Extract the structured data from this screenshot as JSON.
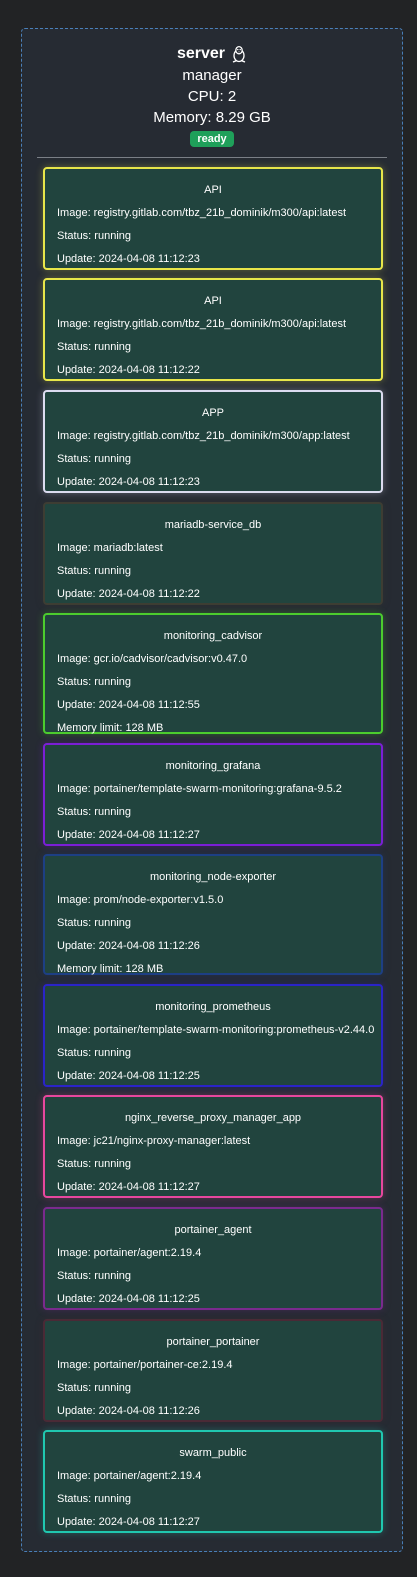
{
  "node": {
    "hostname": "server",
    "os_icon": "linux-tux-icon",
    "role": "manager",
    "cpu": "CPU: 2",
    "memory": "Memory: 8.29 GB",
    "status": "ready",
    "status_color": "#1fa05a",
    "border_color": "#4a7fb8"
  },
  "tasks": [
    {
      "name": "API",
      "image": "Image: registry.gitlab.com/tbz_21b_dominik/m300/api:latest",
      "status": "Status: running",
      "update": "Update: 2024-04-08 11:12:23",
      "color": "#e8e64a"
    },
    {
      "name": "API",
      "image": "Image: registry.gitlab.com/tbz_21b_dominik/m300/api:latest",
      "status": "Status: running",
      "update": "Update: 2024-04-08 11:12:22",
      "color": "#e8e64a"
    },
    {
      "name": "APP",
      "image": "Image: registry.gitlab.com/tbz_21b_dominik/m300/app:latest",
      "status": "Status: running",
      "update": "Update: 2024-04-08 11:12:23",
      "color": "#dcdcf0"
    },
    {
      "name": "mariadb-service_db",
      "image": "Image: mariadb:latest",
      "status": "Status: running",
      "update": "Update: 2024-04-08 11:12:22",
      "color": "#3d3d33"
    },
    {
      "name": "monitoring_cadvisor",
      "image": "Image: gcr.io/cadvisor/cadvisor:v0.47.0",
      "status": "Status: running",
      "update": "Update: 2024-04-08 11:12:55",
      "memory_limit": "Memory limit: 128 MB",
      "color": "#4ccc2e"
    },
    {
      "name": "monitoring_grafana",
      "image": "Image: portainer/template-swarm-monitoring:grafana-9.5.2",
      "status": "Status: running",
      "update": "Update: 2024-04-08 11:12:27",
      "color": "#7b1fd6"
    },
    {
      "name": "monitoring_node-exporter",
      "image": "Image: prom/node-exporter:v1.5.0",
      "status": "Status: running",
      "update": "Update: 2024-04-08 11:12:26",
      "memory_limit": "Memory limit: 128 MB",
      "color": "#1d3f84"
    },
    {
      "name": "monitoring_prometheus",
      "image": "Image: portainer/template-swarm-monitoring:prometheus-v2.44.0",
      "status": "Status: running",
      "update": "Update: 2024-04-08 11:12:25",
      "color": "#2a24c8"
    },
    {
      "name": "nginx_reverse_proxy_manager_app",
      "image": "Image: jc21/nginx-proxy-manager:latest",
      "status": "Status: running",
      "update": "Update: 2024-04-08 11:12:27",
      "color": "#e8479e"
    },
    {
      "name": "portainer_agent",
      "image": "Image: portainer/agent:2.19.4",
      "status": "Status: running",
      "update": "Update: 2024-04-08 11:12:25",
      "color": "#7a2a8e"
    },
    {
      "name": "portainer_portainer",
      "image": "Image: portainer/portainer-ce:2.19.4",
      "status": "Status: running",
      "update": "Update: 2024-04-08 11:12:26",
      "color": "#4a2a36"
    },
    {
      "name": "swarm_public",
      "image": "Image: portainer/agent:2.19.4",
      "status": "Status: running",
      "update": "Update: 2024-04-08 11:12:27",
      "color": "#20c8b0"
    }
  ]
}
